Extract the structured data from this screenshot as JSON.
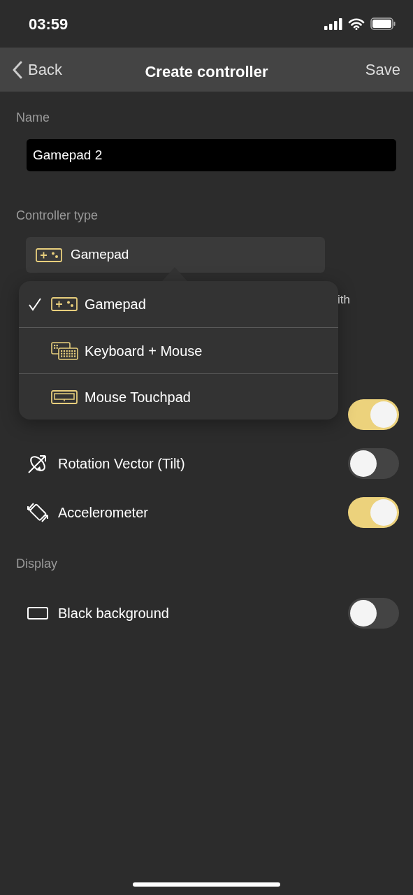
{
  "status_bar": {
    "time": "03:59"
  },
  "nav": {
    "back": "Back",
    "title": "Create controller",
    "save": "Save"
  },
  "name_section": {
    "label": "Name",
    "value": "Gamepad 2"
  },
  "type_section": {
    "label": "Controller type",
    "value": "Gamepad",
    "description_fragment": "ith"
  },
  "menu": [
    {
      "label": "Gamepad",
      "kind": "gamepad",
      "selected": true
    },
    {
      "label": "Keyboard + Mouse",
      "kind": "keyboard",
      "selected": false
    },
    {
      "label": "Mouse Touchpad",
      "kind": "touchpad",
      "selected": false
    }
  ],
  "sensor_rows": [
    {
      "on": true
    },
    {
      "label": "Rotation Vector (Tilt)",
      "kind": "rotation",
      "on": false
    },
    {
      "label": "Accelerometer",
      "kind": "accelerometer",
      "on": true
    }
  ],
  "display_section": {
    "label": "Display",
    "rows": [
      {
        "label": "Black background",
        "kind": "screen",
        "on": false
      }
    ]
  }
}
